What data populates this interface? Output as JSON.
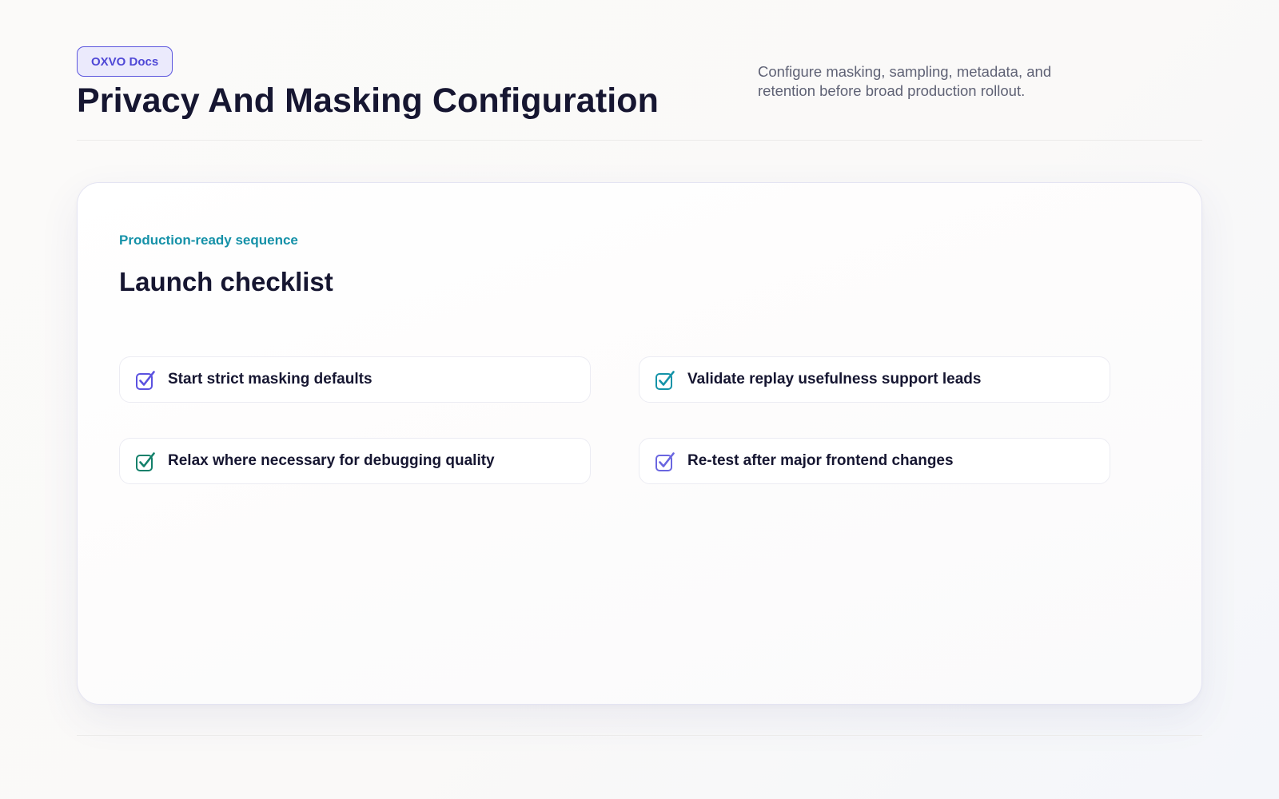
{
  "header": {
    "badge": "OXVO Docs",
    "title": "Privacy And Masking Configuration",
    "subtitle": "Configure masking, sampling, metadata, and retention before broad production rollout."
  },
  "checklist_card": {
    "eyebrow": "Production-ready sequence",
    "title": "Launch checklist",
    "items": [
      {
        "label": "Start strict masking defaults",
        "icon": "checkbox-checked-icon",
        "color": "#5b52e0"
      },
      {
        "label": "Validate replay usefulness support leads",
        "icon": "checkbox-checked-icon",
        "color": "#1493a8"
      },
      {
        "label": "Relax where necessary for debugging quality",
        "icon": "checkbox-checked-icon",
        "color": "#13806a"
      },
      {
        "label": "Re-test after major frontend changes",
        "icon": "checkbox-checked-icon",
        "color": "#6a66e0"
      }
    ]
  },
  "colors": {
    "accent": "#4f48d6",
    "eyebrow": "#1591a8",
    "heading": "#161631",
    "muted": "#5f6275"
  }
}
